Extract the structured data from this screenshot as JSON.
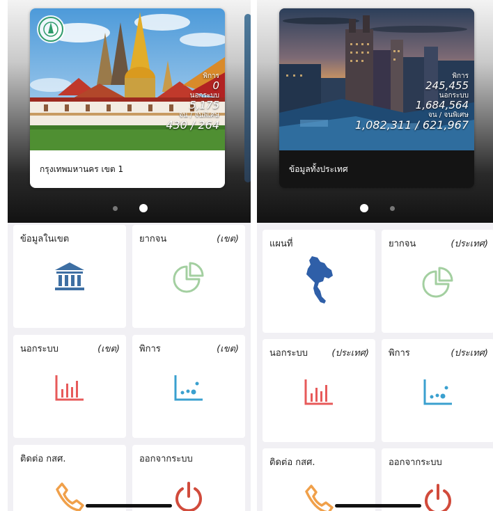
{
  "left": {
    "card": {
      "stats": [
        {
          "label": "พิการ",
          "value": "0"
        },
        {
          "label": "นอกระบบ",
          "value": "5,175"
        },
        {
          "label": "จน / จนพิเศษ",
          "value": "430 / 264"
        }
      ],
      "title": "กรุงเทพมหานคร เขต 1",
      "logo": "district-seal-icon"
    },
    "pager": {
      "count": 2,
      "active_index": 1
    },
    "tiles": [
      {
        "label": "ข้อมูลในเขต",
        "scope": "",
        "icon": "building-icon",
        "color": "#3e6fa3"
      },
      {
        "label": "ยากจน",
        "scope": "(เขต)",
        "icon": "pie-chart-icon",
        "color": "#a3cfa0"
      },
      {
        "label": "นอกระบบ",
        "scope": "(เขต)",
        "icon": "bar-chart-icon",
        "color": "#e75a5a"
      },
      {
        "label": "พิการ",
        "scope": "(เขต)",
        "icon": "scatter-chart-icon",
        "color": "#3aa0cf"
      },
      {
        "label": "ติดต่อ กสศ.",
        "scope": "",
        "icon": "phone-icon",
        "color": "#f0a04a"
      },
      {
        "label": "ออกจากระบบ",
        "scope": "",
        "icon": "power-icon",
        "color": "#d14b3c"
      }
    ]
  },
  "right": {
    "card": {
      "stats": [
        {
          "label": "พิการ",
          "value": "245,455"
        },
        {
          "label": "นอกระบบ",
          "value": "1,684,564"
        },
        {
          "label": "จน / จนพิเศษ",
          "value": "1,082,311 / 621,967"
        }
      ],
      "title": "ข้อมูลทั้งประเทศ"
    },
    "pager": {
      "count": 2,
      "active_index": 0
    },
    "tiles": [
      {
        "label": "แผนที่",
        "scope": "",
        "icon": "thailand-map-icon",
        "color": "#2f5fa8"
      },
      {
        "label": "ยากจน",
        "scope": "(ประเทศ)",
        "icon": "pie-chart-icon",
        "color": "#a3cfa0"
      },
      {
        "label": "นอกระบบ",
        "scope": "(ประเทศ)",
        "icon": "bar-chart-icon",
        "color": "#e75a5a"
      },
      {
        "label": "พิการ",
        "scope": "(ประเทศ)",
        "icon": "scatter-chart-icon",
        "color": "#3aa0cf"
      },
      {
        "label": "ติดต่อ กสศ.",
        "scope": "",
        "icon": "phone-icon",
        "color": "#f0a04a"
      },
      {
        "label": "ออกจากระบบ",
        "scope": "",
        "icon": "power-icon",
        "color": "#d14b3c"
      }
    ]
  }
}
